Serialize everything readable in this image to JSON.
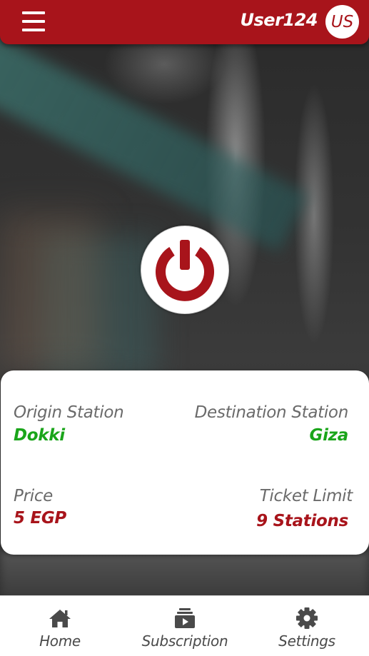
{
  "header": {
    "username": "User124",
    "avatar_initials": "US",
    "brand_color": "#a8141b"
  },
  "power_button": {
    "icon": "power-icon",
    "color": "#a8141b"
  },
  "trip": {
    "origin_label": "Origin Station",
    "origin_value": "Dokki",
    "destination_label": "Destination Station",
    "destination_value": "Giza",
    "price_label": "Price",
    "price_value": "5 EGP",
    "ticket_limit_label": "Ticket Limit",
    "ticket_limit_value": "9 Stations",
    "station_color": "#1aa51a",
    "price_color": "#a8141b"
  },
  "nav": {
    "items": [
      {
        "label": "Home",
        "icon": "home-icon"
      },
      {
        "label": "Subscription",
        "icon": "subscription-icon"
      },
      {
        "label": "Settings",
        "icon": "gear-icon"
      }
    ]
  }
}
